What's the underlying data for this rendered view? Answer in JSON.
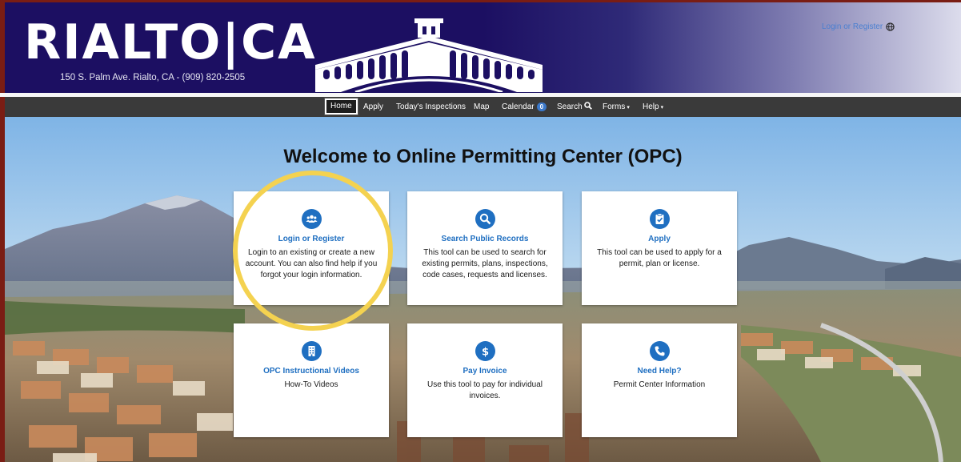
{
  "header": {
    "logo": "RIALTO|CA",
    "address": "150 S. Palm Ave. Rialto, CA - (909) 820-2505",
    "login_link": "Login or Register",
    "globe_icon": "globe-icon"
  },
  "nav": {
    "items": [
      {
        "label": "Home",
        "active": true
      },
      {
        "label": "Apply"
      },
      {
        "label": "Today's Inspections"
      },
      {
        "label": "Map"
      },
      {
        "label": "Calendar",
        "badge": "0"
      },
      {
        "label": "Search",
        "icon": "search-icon"
      },
      {
        "label": "Forms",
        "caret": "▾"
      },
      {
        "label": "Help",
        "caret": "▾"
      }
    ]
  },
  "welcome": "Welcome to Online Permitting Center (OPC)",
  "cards": [
    {
      "icon": "users-icon",
      "title": "Login or Register",
      "description": "Login to an existing or create a new account. You can also find help if you forgot your login information."
    },
    {
      "icon": "search-icon",
      "title": "Search Public Records",
      "description": "This tool can be used to search for existing permits, plans, inspections, code cases, requests and licenses."
    },
    {
      "icon": "clipboard-icon",
      "title": "Apply",
      "description": "This tool can be used to apply for a permit, plan or license."
    },
    {
      "icon": "building-icon",
      "title": "OPC Instructional Videos",
      "description": "How-To Videos"
    },
    {
      "icon": "dollar-icon",
      "title": "Pay Invoice",
      "description": "Use this tool to pay for individual invoices."
    },
    {
      "icon": "phone-icon",
      "title": "Need Help?",
      "description": "Permit Center Information"
    }
  ],
  "colors": {
    "header_bg": "#1c0f62",
    "nav_bg": "#3a3a3a",
    "accent": "#1f6fc1",
    "highlight_ring": "#f4d250"
  }
}
